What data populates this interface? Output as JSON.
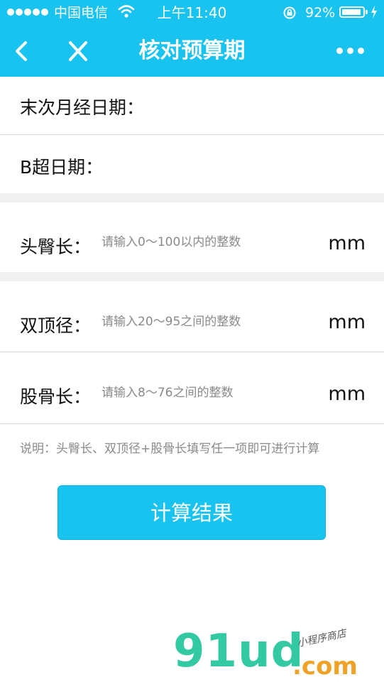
{
  "status_bar": {
    "carrier": "中国电信",
    "time": "上午11:40",
    "battery_percent": "92%",
    "battery_level": 0.92
  },
  "nav": {
    "title": "核对预算期",
    "back_icon": "chevron-left-icon",
    "close_icon": "close-icon",
    "more_icon": "more-dots-icon"
  },
  "form": {
    "lmp": {
      "label": "末次月经日期：",
      "value": ""
    },
    "ultrasound": {
      "label": "B超日期：",
      "value": ""
    },
    "crl": {
      "label": "头臀长：",
      "placeholder": "请输入0～100以内的整数",
      "unit": "mm"
    },
    "bpd": {
      "label": "双顶径：",
      "placeholder": "请输入20～95之间的整数",
      "unit": "mm"
    },
    "fl": {
      "label": "股骨长：",
      "placeholder": "请输入8～76之间的整数",
      "unit": "mm"
    }
  },
  "note": "说明：头臀长、双顶径+股骨长填写任一项即可进行计算",
  "calculate_button": "计算结果",
  "watermark": {
    "logo": "91ud",
    "domain": ".com",
    "tagline": "小程序商店"
  },
  "colors": {
    "accent": "#19c3f0",
    "divider": "#d8d8d8",
    "section_gap": "#f0f0f0"
  }
}
